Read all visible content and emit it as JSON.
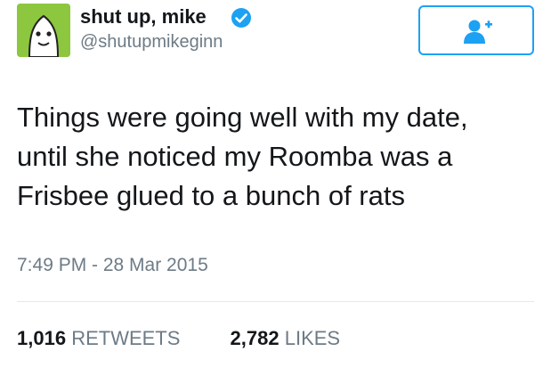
{
  "user": {
    "display_name": "shut up, mike",
    "handle": "@shutupmikeginn",
    "verified": true,
    "avatar_icon": "green-cartoon-face-avatar",
    "avatar_color": "#8dc63f"
  },
  "follow_button": {
    "icon": "add-user-icon",
    "accent_color": "#1da1f2"
  },
  "tweet": {
    "lines": [
      "Things were going well with my date,",
      "until she noticed my Roomba was a",
      "Frisbee glued to a bunch of rats"
    ],
    "timestamp": "7:49 PM - 28 Mar 2015"
  },
  "stats": {
    "retweets_count": "1,016",
    "retweets_label": "RETWEETS",
    "likes_count": "2,782",
    "likes_label": "LIKES"
  }
}
